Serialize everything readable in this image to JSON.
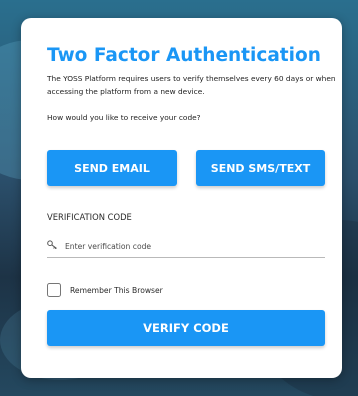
{
  "dialog": {
    "title": "Two Factor Authentication",
    "description": "The YOSS Platform requires users to verify themselves every 60 days or when accessing the platform from a new device.",
    "question": "How would you like to receive your code?",
    "send_email_label": "SEND EMAIL",
    "send_sms_label": "SEND SMS/TEXT",
    "verification_label": "VERIFICATION CODE",
    "code_input": {
      "placeholder": "Enter verification code",
      "value": "",
      "icon": "key-icon"
    },
    "remember_label": "Remember This Browser",
    "remember_checked": false,
    "verify_label": "VERIFY CODE"
  },
  "colors": {
    "accent": "#1a96f5",
    "card_background": "#ffffff",
    "text": "#1e1e1e"
  }
}
